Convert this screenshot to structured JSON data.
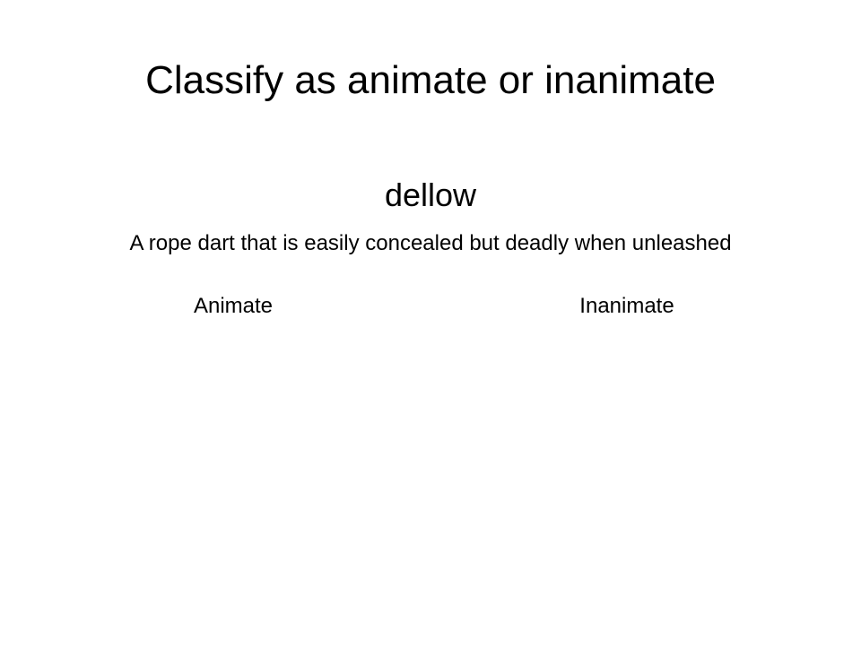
{
  "slide": {
    "title": "Classify as animate or inanimate",
    "word": "dellow",
    "definition": "A rope dart that is easily concealed but deadly when unleashed",
    "options": [
      {
        "label": "Animate"
      },
      {
        "label": "Inanimate"
      }
    ]
  }
}
